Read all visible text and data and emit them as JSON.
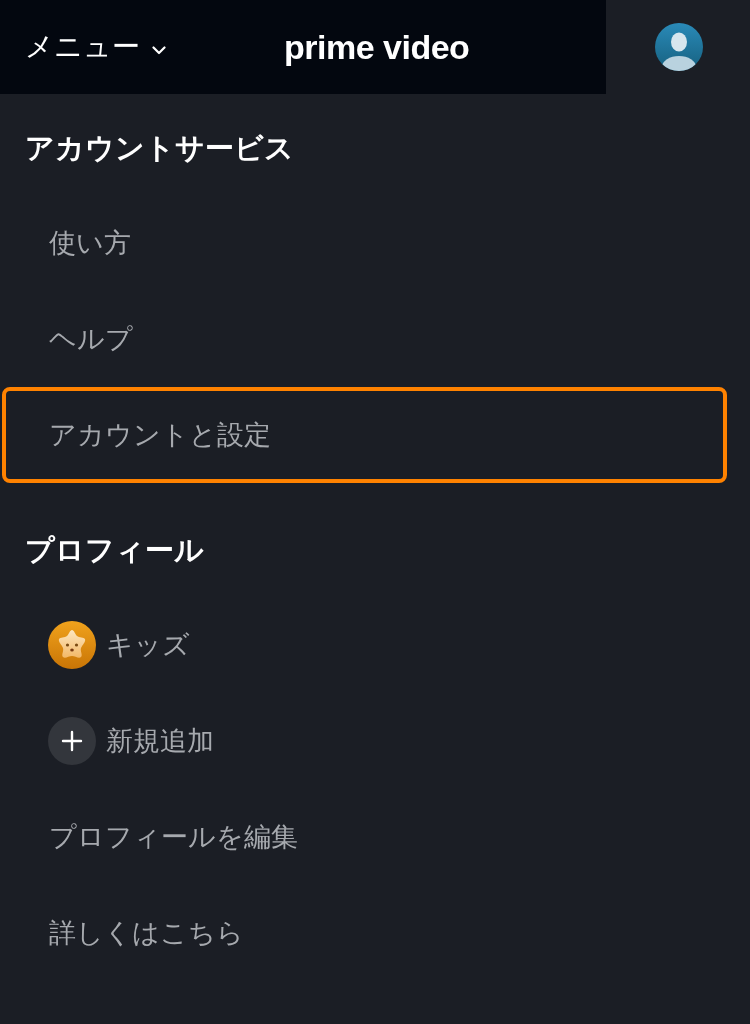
{
  "header": {
    "menu_label": "メニュー",
    "logo": "prime video"
  },
  "sections": [
    {
      "heading": "アカウントサービス",
      "items": [
        {
          "label": "使い方",
          "kind": "text",
          "selected": false
        },
        {
          "label": "ヘルプ",
          "kind": "text",
          "selected": false
        },
        {
          "label": "アカウントと設定",
          "kind": "text",
          "selected": true
        }
      ]
    },
    {
      "heading": "プロフィール",
      "items": [
        {
          "label": "キッズ",
          "kind": "kids",
          "selected": false
        },
        {
          "label": "新規追加",
          "kind": "add",
          "selected": false
        },
        {
          "label": "プロフィールを編集",
          "kind": "text",
          "selected": false
        },
        {
          "label": "詳しくはこちら",
          "kind": "text",
          "selected": false
        }
      ]
    }
  ]
}
